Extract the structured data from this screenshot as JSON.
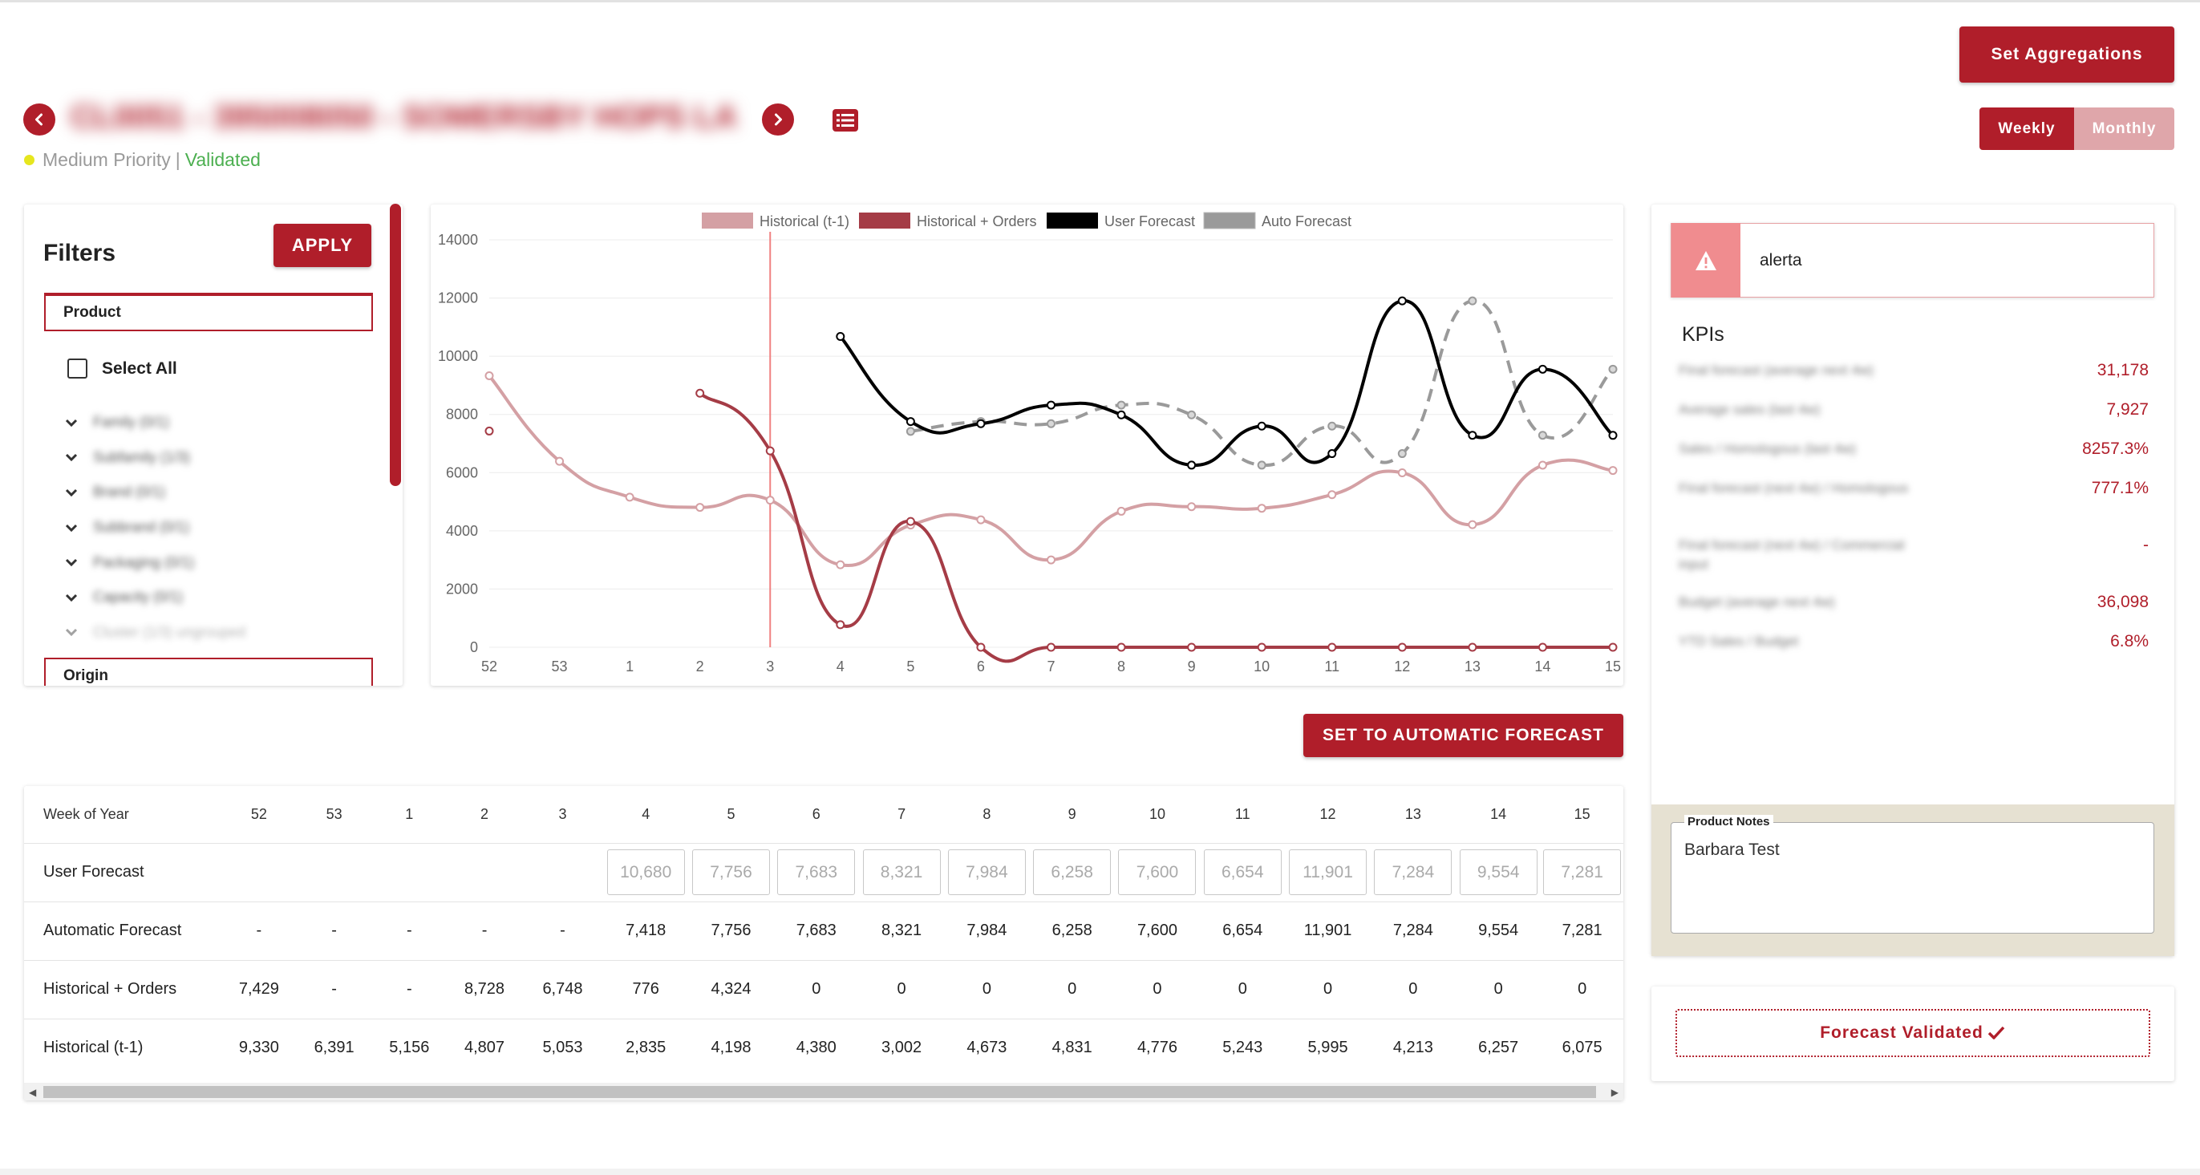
{
  "header": {
    "set_aggregations_label": "Set Aggregations",
    "weekly_label": "Weekly",
    "monthly_label": "Monthly",
    "product_title": "CL0051 - 395008050 - SOMERSBY HOPS LATA E...",
    "priority": "Medium Priority",
    "separator": "|",
    "status": "Validated"
  },
  "filters": {
    "title": "Filters",
    "apply_label": "APPLY",
    "product_label": "Product",
    "select_all_label": "Select All",
    "items": [
      {
        "label": "Family (0/1)"
      },
      {
        "label": "Subfamily (1/3)"
      },
      {
        "label": "Brand (0/1)"
      },
      {
        "label": "Subbrand (0/1)"
      },
      {
        "label": "Packaging (0/1)"
      },
      {
        "label": "Capacity (0/1)"
      },
      {
        "label": "Cluster (1/3) ungrouped"
      }
    ],
    "origin_label": "Origin"
  },
  "chart_data": {
    "type": "line",
    "categories": [
      "52",
      "53",
      "1",
      "2",
      "3",
      "4",
      "5",
      "6",
      "7",
      "8",
      "9",
      "10",
      "11",
      "12",
      "13",
      "14",
      "15"
    ],
    "ylim": [
      0,
      14000
    ],
    "yticks": [
      0,
      2000,
      4000,
      6000,
      8000,
      10000,
      12000,
      14000
    ],
    "current_week": "3",
    "legend_position": "top",
    "series": [
      {
        "name": "Historical (t-1)",
        "color": "#d4a0a4",
        "values": [
          9330,
          6391,
          5156,
          4807,
          5053,
          2835,
          4198,
          4380,
          3002,
          4673,
          4831,
          4776,
          5243,
          5995,
          4213,
          6257,
          6075
        ]
      },
      {
        "name": "Historical + Orders",
        "color": "#a53c46",
        "values": [
          7429,
          null,
          null,
          8728,
          6748,
          776,
          4324,
          0,
          0,
          0,
          0,
          0,
          0,
          0,
          0,
          0,
          0
        ]
      },
      {
        "name": "User Forecast",
        "color": "#000000",
        "values": [
          null,
          null,
          null,
          null,
          null,
          10680,
          7756,
          7683,
          8321,
          7984,
          6258,
          7600,
          6654,
          11901,
          7284,
          9554,
          7281
        ]
      },
      {
        "name": "Auto Forecast",
        "color": "#9a9a9a",
        "dashed": true,
        "values": [
          null,
          null,
          null,
          null,
          null,
          null,
          7418,
          7756,
          7683,
          8321,
          7984,
          6258,
          7600,
          6654,
          11901,
          7284,
          9554
        ]
      }
    ]
  },
  "actions": {
    "set_auto_label": "SET TO AUTOMATIC FORECAST"
  },
  "table": {
    "header_label": "Week of Year",
    "weeks": [
      "52",
      "53",
      "1",
      "2",
      "3",
      "4",
      "5",
      "6",
      "7",
      "8",
      "9",
      "10",
      "11",
      "12",
      "13",
      "14",
      "15"
    ],
    "rows": [
      {
        "label": "User Forecast",
        "editable": true,
        "values": [
          "",
          "",
          "",
          "",
          "",
          "10,680",
          "7,756",
          "7,683",
          "8,321",
          "7,984",
          "6,258",
          "7,600",
          "6,654",
          "11,901",
          "7,284",
          "9,554",
          "7,281"
        ]
      },
      {
        "label": "Automatic Forecast",
        "editable": false,
        "values": [
          "-",
          "-",
          "-",
          "-",
          "-",
          "7,418",
          "7,756",
          "7,683",
          "8,321",
          "7,984",
          "6,258",
          "7,600",
          "6,654",
          "11,901",
          "7,284",
          "9,554",
          "7,281"
        ]
      },
      {
        "label": "Historical + Orders",
        "editable": false,
        "values": [
          "7,429",
          "-",
          "-",
          "8,728",
          "6,748",
          "776",
          "4,324",
          "0",
          "0",
          "0",
          "0",
          "0",
          "0",
          "0",
          "0",
          "0",
          "0"
        ]
      },
      {
        "label": "Historical (t-1)",
        "editable": false,
        "values": [
          "9,330",
          "6,391",
          "5,156",
          "4,807",
          "5,053",
          "2,835",
          "4,198",
          "4,380",
          "3,002",
          "4,673",
          "4,831",
          "4,776",
          "5,243",
          "5,995",
          "4,213",
          "6,257",
          "6,075"
        ]
      }
    ]
  },
  "kpi_panel": {
    "alert_text": "alerta",
    "kpis_title": "KPIs",
    "kpis": [
      {
        "label": "Final forecast (average next 4w)",
        "value": "31,178"
      },
      {
        "label": "Average sales (last 4w)",
        "value": "7,927"
      },
      {
        "label": "Sales / Homologous (last 4w)",
        "value": "8257.3%"
      },
      {
        "label": "Final forecast (next 4w) / Homologous",
        "value": "777.1%"
      },
      {
        "label": "Final forecast (next 4w) / Commercial input",
        "value": "-"
      },
      {
        "label": "Budget (average next 4w)",
        "value": "36,098"
      },
      {
        "label": "YTD Sales / Budget",
        "value": "6.8%"
      }
    ],
    "notes_label": "Product Notes",
    "notes_text": "Barbara Test",
    "validated_label": "Forecast Validated"
  },
  "colors": {
    "primary": "#b01e2a",
    "primary_light": "#dfa6aa",
    "validated_green": "#4caf50",
    "priority_yellow": "#e6e61e",
    "alert_pink": "#f08c8f"
  }
}
